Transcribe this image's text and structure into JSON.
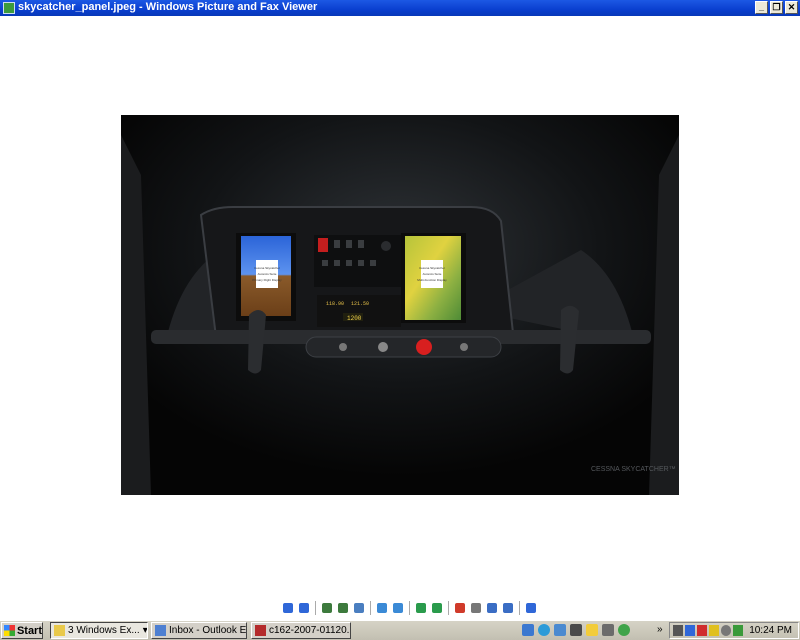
{
  "window": {
    "title": "skycatcher_panel.jpeg - Windows Picture and Fax Viewer",
    "buttons": {
      "minimize": "_",
      "maximize": "❐",
      "close": "✕"
    }
  },
  "image": {
    "mfd_left_text": [
      "Cessna Skycatcher",
      "Avionics Suite",
      "Primary Flight Display"
    ],
    "mfd_right_text": [
      "Cessna Skycatcher",
      "Avionics Suite",
      "Multi-Function Display"
    ],
    "radio_active": "118.90",
    "radio_standby": "121.50",
    "transponder": "1200",
    "watermark": "CESSNA SKYCATCHER™"
  },
  "toolbar": {
    "items": [
      {
        "name": "previous-image-button",
        "color": "#2f67d8"
      },
      {
        "name": "next-image-button",
        "color": "#2f67d8"
      },
      {
        "name": "best-fit-button",
        "color": "#3d7a3d"
      },
      {
        "name": "actual-size-button",
        "color": "#3d7a3d"
      },
      {
        "name": "slideshow-button",
        "color": "#4a7ec0"
      },
      {
        "name": "zoom-in-button",
        "color": "#3b8ad6"
      },
      {
        "name": "zoom-out-button",
        "color": "#3b8ad6"
      },
      {
        "name": "rotate-clockwise-button",
        "color": "#2a9b4c"
      },
      {
        "name": "rotate-counterclockwise-button",
        "color": "#2a9b4c"
      },
      {
        "name": "delete-button",
        "color": "#d03a2a"
      },
      {
        "name": "print-button",
        "color": "#777777"
      },
      {
        "name": "copy-to-button",
        "color": "#3a6dc4"
      },
      {
        "name": "open-for-editing-button",
        "color": "#3a6dc4"
      },
      {
        "name": "help-button",
        "color": "#2f67d8"
      }
    ]
  },
  "taskbar": {
    "start_label": "Start",
    "buttons": [
      {
        "label": "3 Windows Ex...",
        "active": true
      },
      {
        "label": "Inbox - Outlook E..."
      },
      {
        "label": "c162-2007-01120..."
      }
    ],
    "clock": "10:24 PM"
  }
}
